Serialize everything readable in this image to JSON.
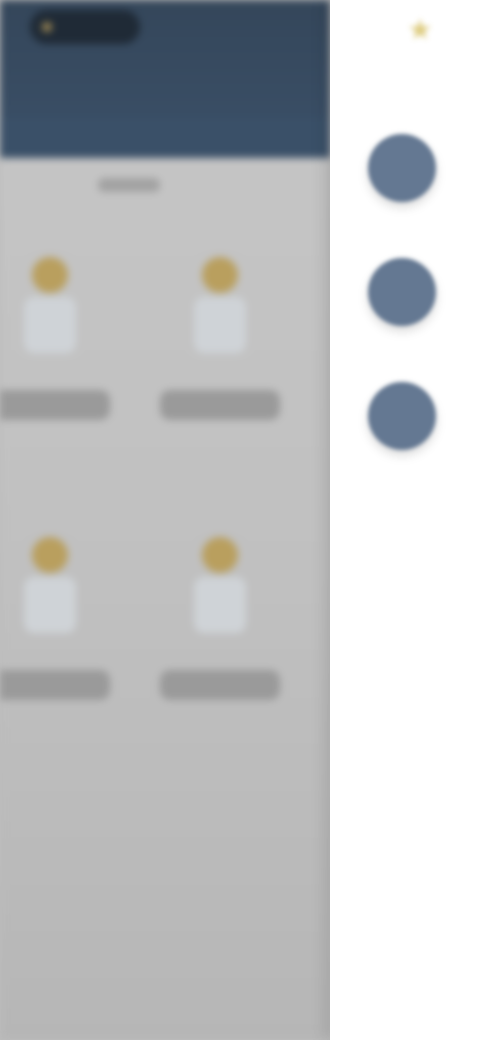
{
  "colors": {
    "header": "#3b5068",
    "dim_overlay": "#bdbdbd",
    "rail_background": "#ffffff",
    "rail_button": "#647892",
    "accent_gold": "#d8c36a"
  },
  "rail": {
    "top_icon": "star-icon",
    "top_label": "",
    "buttons": [
      {
        "icon": "action-icon-1",
        "label": ""
      },
      {
        "icon": "action-icon-2",
        "label": ""
      },
      {
        "icon": "action-icon-3",
        "label": ""
      }
    ]
  },
  "grid": {
    "cards": [
      {
        "icon": "star-icon",
        "label": ""
      },
      {
        "icon": "star-icon",
        "label": ""
      },
      {
        "icon": "star-icon",
        "label": ""
      },
      {
        "icon": "star-icon",
        "label": ""
      }
    ]
  }
}
